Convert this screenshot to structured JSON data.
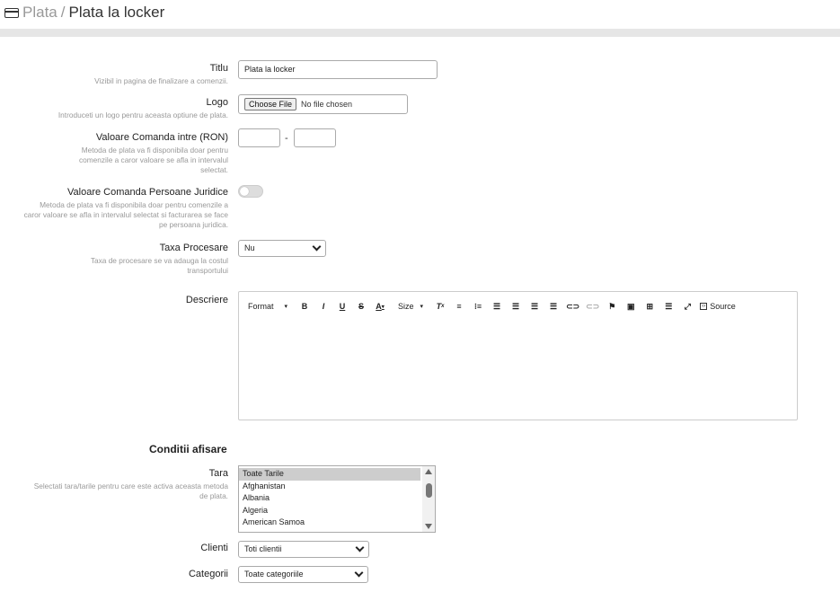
{
  "breadcrumb": {
    "parent": "Plata",
    "separator": "/",
    "current": "Plata la locker"
  },
  "form": {
    "titlu": {
      "label": "Titlu",
      "help": "Vizibil in pagina de finalizare a comenzii.",
      "value": "Plata la locker"
    },
    "logo": {
      "label": "Logo",
      "help": "Introduceti un logo pentru aceasta optiune de plata.",
      "button": "Choose File",
      "status": "No file chosen"
    },
    "valoare": {
      "label": "Valoare Comanda intre (RON)",
      "help": "Metoda de plata va fi disponibila doar pentru comenzile a caror valoare se afla in intervalul selectat.",
      "separator": "-",
      "min": "",
      "max": ""
    },
    "juridice": {
      "label": "Valoare Comanda Persoane Juridice",
      "help": "Metoda de plata va fi disponibila doar pentru comenzile a caror valoare se afla in intervalul selectat si facturarea se face pe persoana juridica.",
      "enabled": false
    },
    "taxa": {
      "label": "Taxa Procesare",
      "help": "Taxa de procesare se va adauga la costul transportului",
      "value": "Nu"
    },
    "descriere": {
      "label": "Descriere",
      "toolbar": {
        "format": "Format",
        "size": "Size",
        "source": "Source"
      }
    }
  },
  "conditii": {
    "title": "Conditii afisare",
    "tara": {
      "label": "Tara",
      "help": "Selectati tara/tarile pentru care este activa aceasta metoda de plata.",
      "options": [
        "Toate Tarile",
        "Afghanistan",
        "Albania",
        "Algeria",
        "American Samoa"
      ],
      "selected": "Toate Tarile"
    },
    "clienti": {
      "label": "Clienti",
      "value": "Toti clientii"
    },
    "categorii": {
      "label": "Categorii",
      "value": "Toate categoriile"
    }
  }
}
